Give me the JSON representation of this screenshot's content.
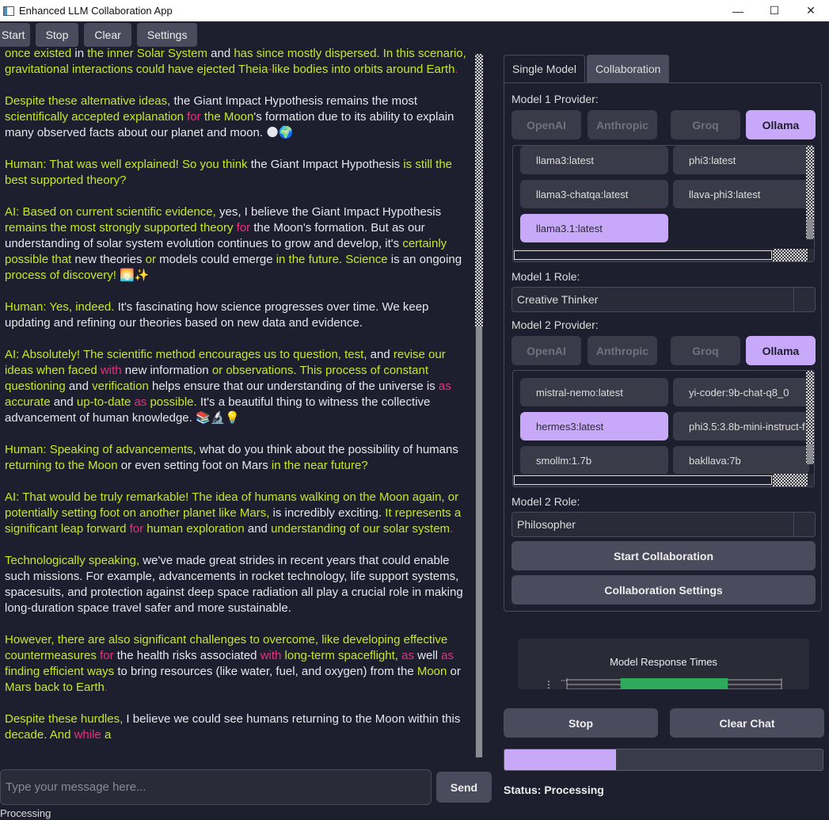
{
  "window": {
    "title": "Enhanced LLM Collaboration App"
  },
  "menu": [
    "Start",
    "Stop",
    "Clear",
    "Settings"
  ],
  "chat": {
    "paragraphs": [
      [
        [
          "g",
          "once existed "
        ],
        [
          "w",
          "in "
        ],
        [
          "g",
          "the inner Solar System "
        ],
        [
          "w",
          "and "
        ],
        [
          "g",
          "has since mostly dispersed. In this scenario, gravitational interactions could have ejected Theia"
        ],
        [
          "p",
          "-"
        ],
        [
          "g",
          "like bodies into orbits around Earth"
        ],
        [
          "p",
          "."
        ]
      ],
      [
        [
          "g",
          "Despite these alternative ideas, "
        ],
        [
          "w",
          "the Giant Impact Hypothesis remains the most "
        ],
        [
          "g",
          "scientifically accepted explanation "
        ],
        [
          "p",
          "for "
        ],
        [
          "g",
          "the Moon"
        ],
        [
          "w",
          "'s formation due to its ability to explain many observed facts about our planet and moon. 🌑🌍"
        ]
      ],
      [
        [
          "g",
          "Human: That was well explained! So you think "
        ],
        [
          "w",
          "the Giant Impact Hypothesis "
        ],
        [
          "g",
          "is still the best supported theory?"
        ]
      ],
      [
        [
          "g",
          "AI: Based on current scientific evidence, "
        ],
        [
          "w",
          "yes, I believe the Giant Impact Hypothesis "
        ],
        [
          "g",
          "remains the most strongly supported theory "
        ],
        [
          "p",
          "for "
        ],
        [
          "w",
          "the Moon's formation. But as our understanding of solar system evolution continues to grow and develop, it's "
        ],
        [
          "g",
          "certainly possible that "
        ],
        [
          "w",
          "new theories "
        ],
        [
          "g",
          "or "
        ],
        [
          "w",
          "models could emerge "
        ],
        [
          "g",
          "in the future. Science "
        ],
        [
          "w",
          "is an ongoing "
        ],
        [
          "g",
          "process of discovery! 🌅✨"
        ]
      ],
      [
        [
          "g",
          "Human: Yes, indeed. "
        ],
        [
          "w",
          "It's fascinating how science progresses over time. We keep updating and refining our theories based on new data and evidence."
        ]
      ],
      [
        [
          "g",
          "AI: Absolutely! The scientific method encourages us to question, test, "
        ],
        [
          "w",
          "and "
        ],
        [
          "g",
          "revise our ideas when faced "
        ],
        [
          "p",
          "with "
        ],
        [
          "w",
          "new information "
        ],
        [
          "g",
          "or observations. This process of constant questioning "
        ],
        [
          "w",
          "and "
        ],
        [
          "g",
          "verification "
        ],
        [
          "w",
          "helps ensure that our understanding of the universe is "
        ],
        [
          "p",
          "as "
        ],
        [
          "g",
          "accurate "
        ],
        [
          "w",
          "and "
        ],
        [
          "g",
          "up-to-date "
        ],
        [
          "p",
          "as "
        ],
        [
          "g",
          "possible. "
        ],
        [
          "w",
          "It's a beautiful thing to witness the collective advancement of human knowledge. 📚🔬💡"
        ]
      ],
      [
        [
          "g",
          "Human: Speaking of advancements, "
        ],
        [
          "w",
          "what do you think about the possibility of humans "
        ],
        [
          "g",
          "returning to the Moon "
        ],
        [
          "w",
          "or even setting foot on Mars "
        ],
        [
          "g",
          "in the near future?"
        ]
      ],
      [
        [
          "g",
          "AI: That would be truly remarkable! The idea of humans walking on the Moon again, or potentially setting foot on another planet like Mars, "
        ],
        [
          "w",
          "is incredibly exciting. "
        ],
        [
          "g",
          "It represents a significant leap forward "
        ],
        [
          "p",
          "for "
        ],
        [
          "g",
          "human exploration "
        ],
        [
          "w",
          "and "
        ],
        [
          "g",
          "understanding of our solar system"
        ],
        [
          "p",
          "."
        ]
      ],
      [
        [
          "g",
          "Technologically speaking, "
        ],
        [
          "w",
          "we've made great strides in recent years that could enable such missions. For example, advancements in rocket technology, life support systems, spacesuits, and protection against deep space radiation all play a crucial role in making long-duration space travel safer and more sustainable."
        ]
      ],
      [
        [
          "g",
          "However, there are also significant challenges to overcome, like developing effective countermeasures "
        ],
        [
          "p",
          "for "
        ],
        [
          "w",
          "the health risks associated "
        ],
        [
          "p",
          "with "
        ],
        [
          "g",
          "long-term spaceflight, "
        ],
        [
          "p",
          "as "
        ],
        [
          "w",
          "well "
        ],
        [
          "p",
          "as "
        ],
        [
          "g",
          "finding efficient ways "
        ],
        [
          "w",
          "to bring resources (like water, fuel, and oxygen) from the "
        ],
        [
          "g",
          "Moon "
        ],
        [
          "w",
          "or "
        ],
        [
          "g",
          "Mars back to Earth"
        ],
        [
          "p",
          "."
        ]
      ],
      [
        [
          "g",
          "Despite these hurdles, "
        ],
        [
          "w",
          "I believe we could see humans returning to the Moon within this "
        ],
        [
          "g",
          "decade. And "
        ],
        [
          "p",
          "while "
        ],
        [
          "g",
          "a"
        ]
      ]
    ]
  },
  "input": {
    "placeholder": "Type your message here...",
    "send_label": "Send"
  },
  "bottom_status": "Processing",
  "tabs": [
    "Single Model",
    "Collaboration"
  ],
  "model1": {
    "provider_label": "Model 1 Provider:",
    "providers": [
      "OpenAI",
      "Anthropic",
      "Groq",
      "Ollama"
    ],
    "models": [
      "llama3:latest",
      "phi3:latest",
      "llama3-chatqa:latest",
      "llava-phi3:latest",
      "llama3.1:latest"
    ],
    "selected_model": "llama3.1:latest",
    "role_label": "Model 1 Role:",
    "role": "Creative Thinker"
  },
  "model2": {
    "provider_label": "Model 2 Provider:",
    "providers": [
      "OpenAI",
      "Anthropic",
      "Groq",
      "Ollama"
    ],
    "models": [
      "mistral-nemo:latest",
      "yi-coder:9b-chat-q8_0",
      "hermes3:latest",
      "phi3.5:3.8b-mini-instruct-f",
      "smollm:1.7b",
      "bakllava:7b"
    ],
    "selected_model": "hermes3:latest",
    "role_label": "Model 2 Role:",
    "role": "Philosopher"
  },
  "selected_provider": "Ollama",
  "buttons": {
    "start_collab": "Start Collaboration",
    "collab_settings": "Collaboration Settings",
    "stop": "Stop",
    "clear_chat": "Clear Chat"
  },
  "chart_data": {
    "type": "bar",
    "title": "Model Response Times",
    "orientation": "horizontal",
    "values": [
      0.5
    ]
  },
  "progress": 0.35,
  "status": "Status: Processing",
  "colors": {
    "background": "#1e1f2e",
    "accent": "#c8a8f8",
    "chat_green": "#c2e82a",
    "chat_pink": "#e8307c",
    "bar_green": "#2eaa5c"
  }
}
